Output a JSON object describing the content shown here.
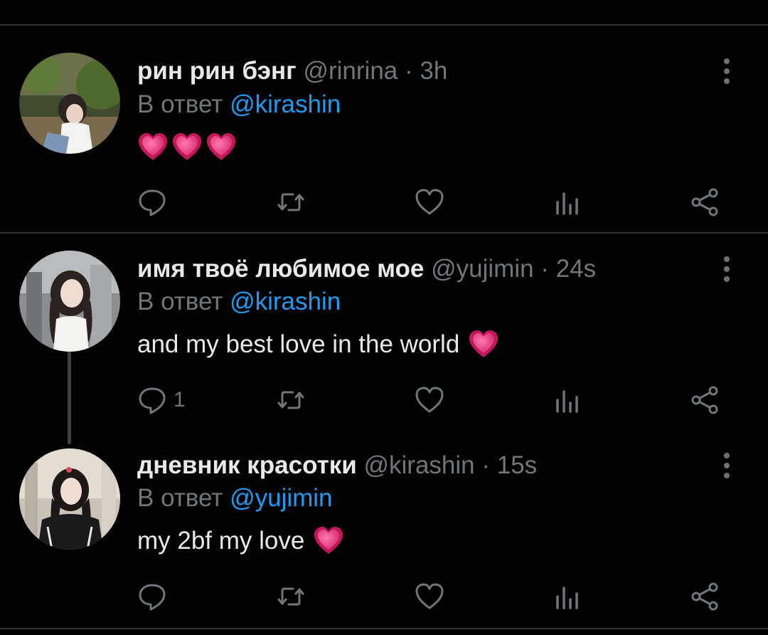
{
  "tweets": [
    {
      "name": "рин рин бэнг",
      "handle": "@rinrina",
      "time": "3h",
      "reply_prefix": "В ответ",
      "reply_to": "@kirashin",
      "text": "",
      "emoji": [
        "heart-pink",
        "heart-pink",
        "heart-pink"
      ],
      "reply_count": ""
    },
    {
      "name": "имя твоё любимое мое",
      "handle": "@yujimin",
      "time": "24s",
      "reply_prefix": "В ответ",
      "reply_to": "@kirashin",
      "text": "and my best love in the world",
      "emoji": [
        "heart-pink"
      ],
      "reply_count": "1"
    },
    {
      "name": "дневник красотки",
      "handle": "@kirashin",
      "time": "15s",
      "reply_prefix": "В ответ",
      "reply_to": "@yujimin",
      "text": "my 2bf my love",
      "emoji": [
        "heart-pink"
      ],
      "reply_count": ""
    }
  ],
  "separator": "·",
  "colors": {
    "background": "#000000",
    "text": "#e7e9ea",
    "muted": "#71767b",
    "link": "#1d9bf0",
    "divider": "#2f3336",
    "heart": "#f04d8a"
  },
  "icons": {
    "actions": [
      "reply-icon",
      "retweet-icon",
      "like-icon",
      "views-icon",
      "share-icon"
    ],
    "menu": "more-vertical-icon"
  }
}
